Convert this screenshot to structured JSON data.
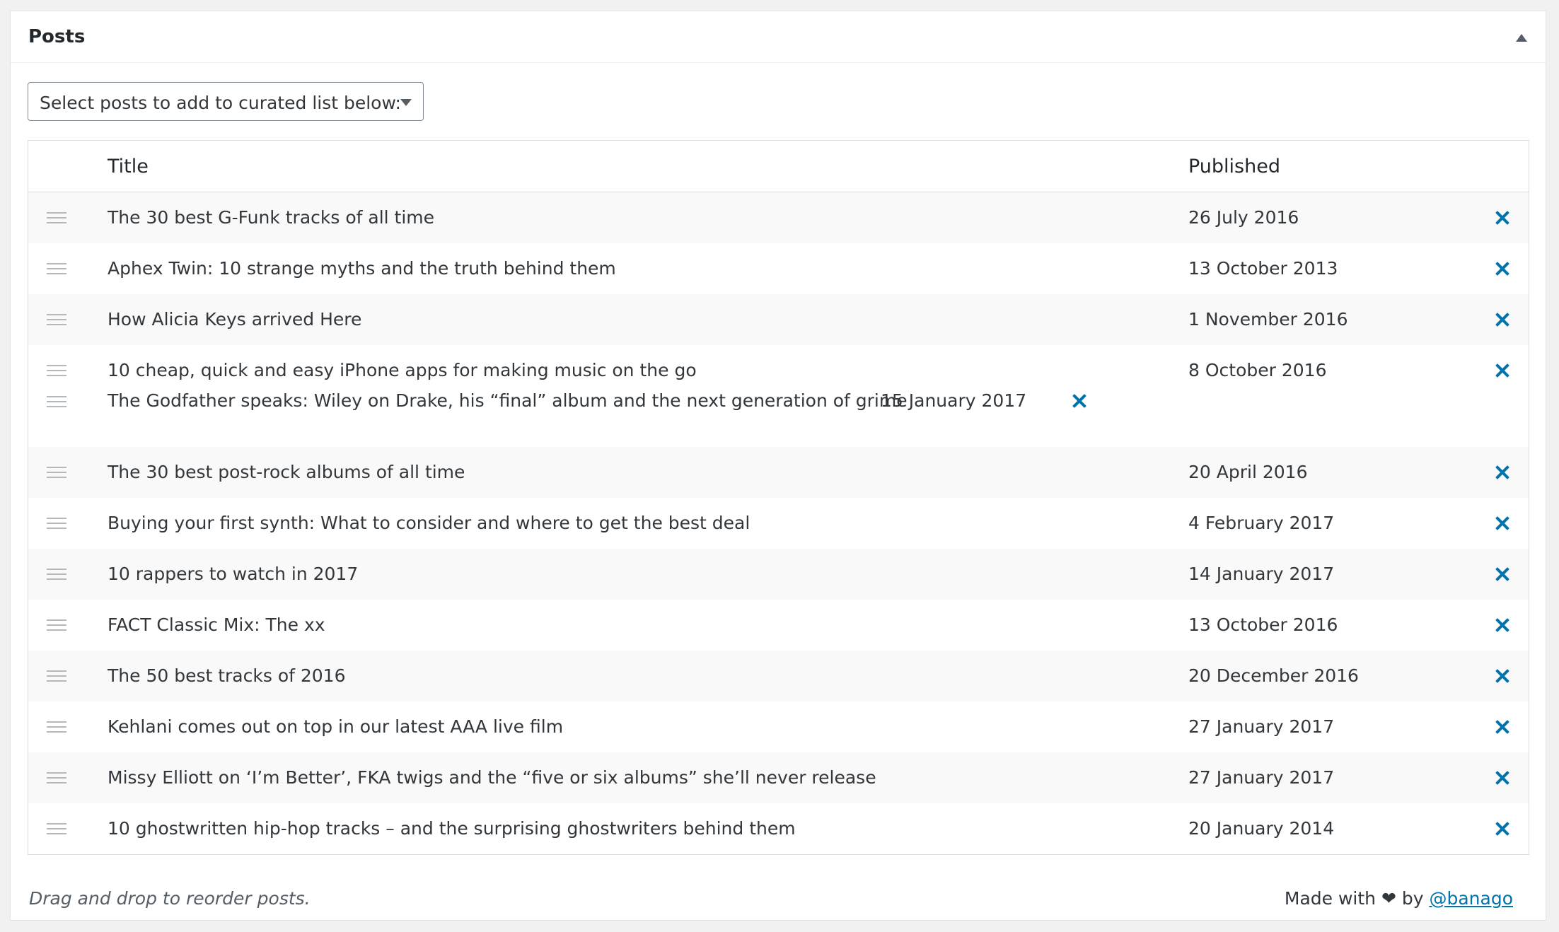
{
  "postbox": {
    "title": "Posts"
  },
  "select": {
    "placeholder": "Select posts to add to curated list below:"
  },
  "table": {
    "columns": {
      "title": "Title",
      "published": "Published"
    },
    "rows": [
      {
        "title": "The 30 best G-Funk tracks of all time",
        "date": "26 July 2016"
      },
      {
        "title": "Aphex Twin: 10 strange myths and the truth behind them",
        "date": "13 October 2013"
      },
      {
        "title": "How Alicia Keys arrived Here",
        "date": "1 November 2016"
      },
      {
        "title": "10 cheap, quick and easy iPhone apps for making music on the go",
        "date": "8 October 2016"
      },
      {
        "title": "The 30 best post-rock albums of all time",
        "date": "20 April 2016"
      },
      {
        "title": "Buying your first synth: What to consider and where to get the best deal",
        "date": "4 February 2017"
      },
      {
        "title": "10 rappers to watch in 2017",
        "date": "14 January 2017"
      },
      {
        "title": "FACT Classic Mix: The xx",
        "date": "13 October 2016"
      },
      {
        "title": "The 50 best tracks of 2016",
        "date": "20 December 2016"
      },
      {
        "title": "Kehlani comes out on top in our latest AAA live film",
        "date": "27 January 2017"
      },
      {
        "title": "Missy Elliott on ‘I’m Better’, FKA twigs and the “five or six albums” she’ll never release",
        "date": "27 January 2017"
      },
      {
        "title": "10 ghostwritten hip-hop tracks – and the surprising ghostwriters behind them",
        "date": "20 January 2014"
      }
    ],
    "dragging": {
      "title": "The Godfather speaks: Wiley on Drake, his “final” album and the next generation of grime",
      "date": "15 January 2017"
    }
  },
  "footer": {
    "note": "Drag and drop to reorder posts.",
    "credit_prefix": "Made with ❤ by",
    "credit_link": "@banago"
  },
  "colors": {
    "accent": "#0073aa",
    "row_alt": "#f9f9f9"
  }
}
